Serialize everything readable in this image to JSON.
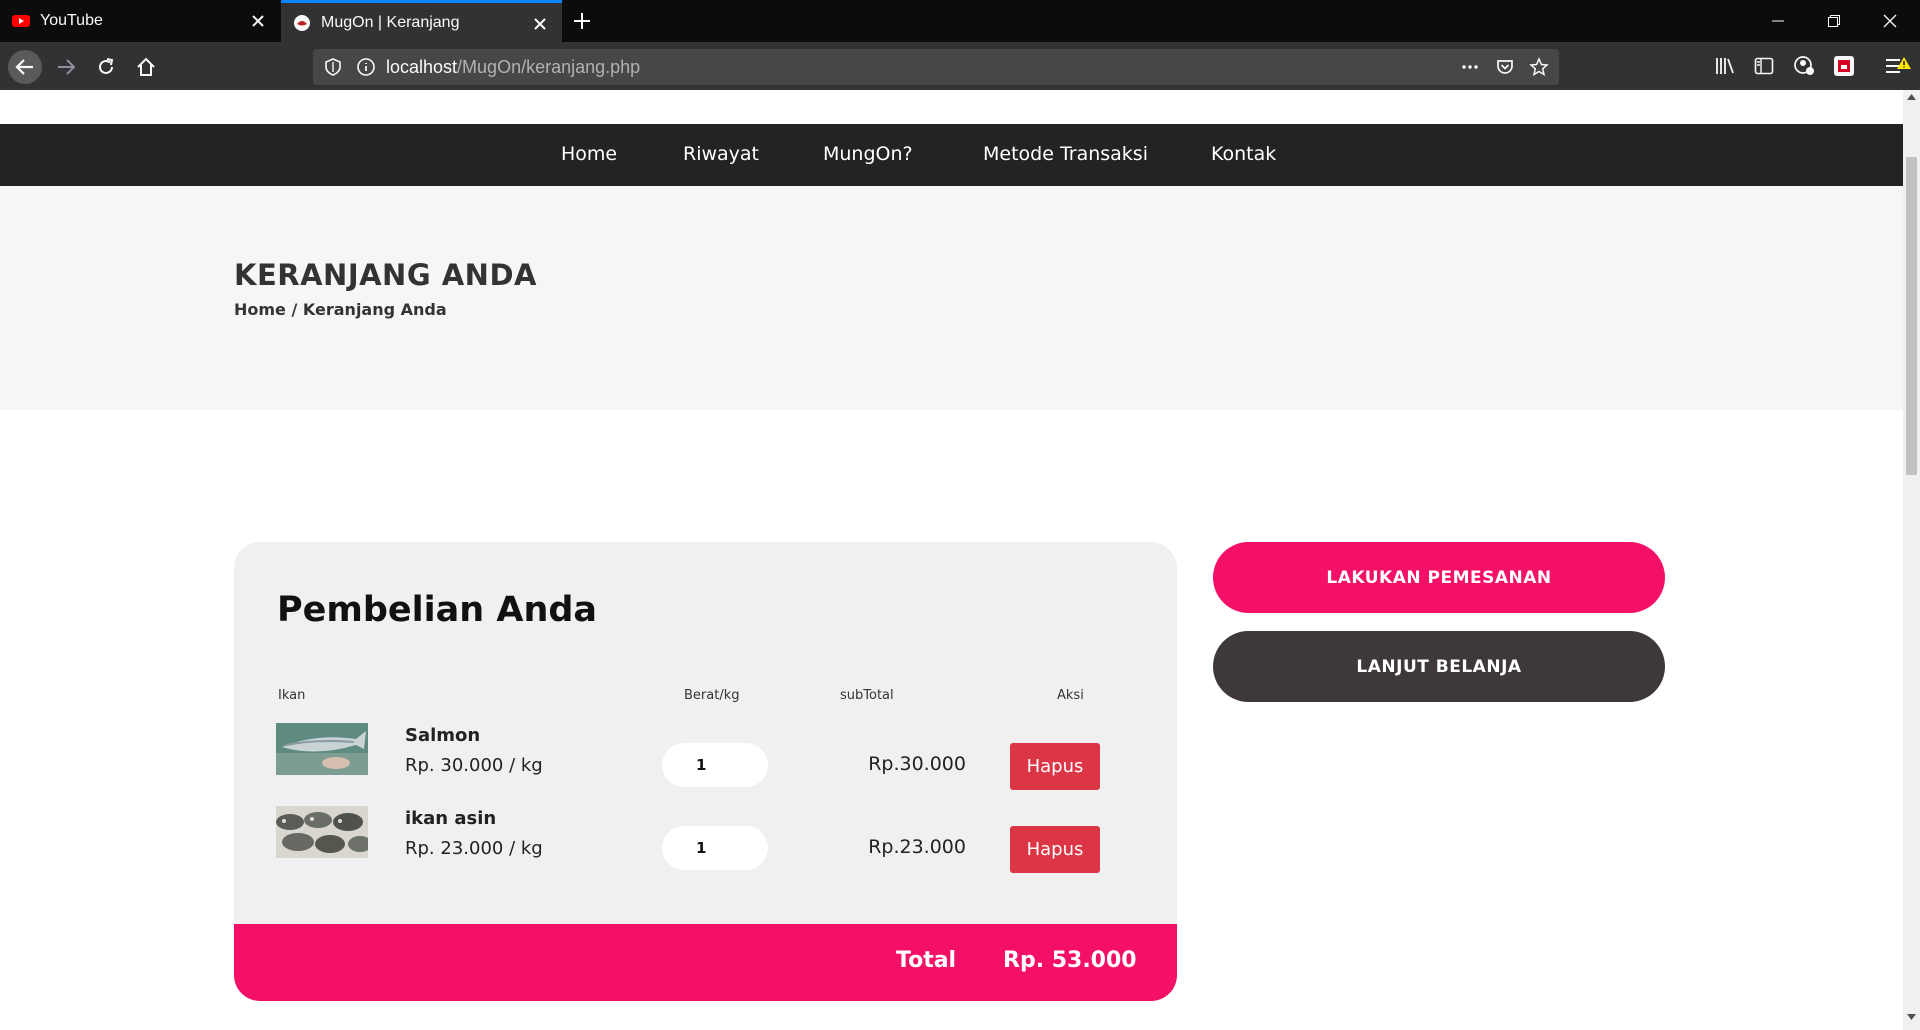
{
  "browser": {
    "tabs": [
      {
        "title": "YouTube",
        "icon": "youtube-icon",
        "active": false
      },
      {
        "title": "MugOn | Keranjang",
        "icon": "site-favicon",
        "active": true
      }
    ],
    "url_host": "localhost",
    "url_path": "/MugOn/keranjang.php",
    "accent": "#0a84ff"
  },
  "site_nav": {
    "items": [
      "Home",
      "Riwayat",
      "MungOn?",
      "Metode Transaksi",
      "Kontak"
    ]
  },
  "hero": {
    "title": "KERANJANG ANDA",
    "breadcrumb": "Home / Keranjang Anda"
  },
  "cart": {
    "title": "Pembelian Anda",
    "columns": {
      "fish": "Ikan",
      "weight": "Berat/kg",
      "subtotal": "subTotal",
      "action": "Aksi"
    },
    "items": [
      {
        "name": "Salmon",
        "price": "Rp. 30.000 / kg",
        "qty": "1",
        "subtotal": "Rp.30.000",
        "action": "Hapus"
      },
      {
        "name": "ikan asin",
        "price": "Rp. 23.000 / kg",
        "qty": "1",
        "subtotal": "Rp.23.000",
        "action": "Hapus"
      }
    ],
    "total_label": "Total",
    "total_value": "Rp. 53.000"
  },
  "actions": {
    "order": "LAKUKAN PEMESANAN",
    "continue": "LANJUT BELANJA"
  },
  "colors": {
    "primary": "#f41066",
    "dark": "#3e3838",
    "danger": "#dc3545",
    "nav_bg": "#232323"
  }
}
